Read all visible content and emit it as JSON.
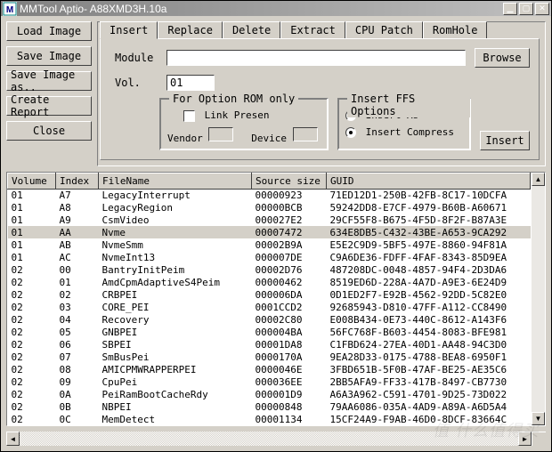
{
  "window": {
    "title": "MMTool Aptio- A88XMD3H.10a"
  },
  "sidebar": {
    "buttons": [
      {
        "label": "Load Image"
      },
      {
        "label": "Save Image"
      },
      {
        "label": "Save Image as.."
      },
      {
        "label": "Create Report"
      },
      {
        "label": "Close"
      }
    ]
  },
  "tabs": [
    {
      "label": "Insert",
      "active": true
    },
    {
      "label": "Replace"
    },
    {
      "label": "Delete"
    },
    {
      "label": "Extract"
    },
    {
      "label": "CPU Patch"
    },
    {
      "label": "RomHole"
    }
  ],
  "insert_tab": {
    "module_label": "Module",
    "module_value": "",
    "browse_label": "Browse",
    "vol_label": "Vol.",
    "vol_value": "01",
    "option_rom_group": {
      "legend": "For Option ROM only",
      "link_presen_label": "Link Presen",
      "link_presen_checked": false,
      "vendor_label": "Vendor",
      "vendor_value": "",
      "device_label": "Device",
      "device_value": ""
    },
    "ffs_group": {
      "legend": "Insert FFS Options",
      "insert_as_label": "Insert As",
      "insert_compress_label": "Insert Compress",
      "selected": "compress"
    },
    "insert_button_label": "Insert"
  },
  "table": {
    "columns": [
      "Volume",
      "Index",
      "FileName",
      "Source size",
      "GUID"
    ],
    "selected_index": 3,
    "rows": [
      {
        "vol": "01",
        "idx": "A7",
        "name": "LegacyInterrupt",
        "size": "00000923",
        "guid": "71ED12D1-250B-42FB-8C17-10DCFA"
      },
      {
        "vol": "01",
        "idx": "A8",
        "name": "LegacyRegion",
        "size": "00000BCB",
        "guid": "59242DD8-E7CF-4979-B60B-A60671"
      },
      {
        "vol": "01",
        "idx": "A9",
        "name": "CsmVideo",
        "size": "000027E2",
        "guid": "29CF55F8-B675-4F5D-8F2F-B87A3E"
      },
      {
        "vol": "01",
        "idx": "AA",
        "name": "Nvme",
        "size": "00007472",
        "guid": "634E8DB5-C432-43BE-A653-9CA292"
      },
      {
        "vol": "01",
        "idx": "AB",
        "name": "NvmeSmm",
        "size": "00002B9A",
        "guid": "E5E2C9D9-5BF5-497E-8860-94F81A"
      },
      {
        "vol": "01",
        "idx": "AC",
        "name": "NvmeInt13",
        "size": "000007DE",
        "guid": "C9A6DE36-FDFF-4FAF-8343-85D9EA"
      },
      {
        "vol": "02",
        "idx": "00",
        "name": "BantryInitPeim",
        "size": "00002D76",
        "guid": "487208DC-0048-4857-94F4-2D3DA6"
      },
      {
        "vol": "02",
        "idx": "01",
        "name": "AmdCpmAdaptiveS4Peim",
        "size": "00000462",
        "guid": "8519ED6D-228A-4A7D-A9E3-6E24D9"
      },
      {
        "vol": "02",
        "idx": "02",
        "name": "CRBPEI",
        "size": "000006DA",
        "guid": "0D1ED2F7-E92B-4562-92DD-5C82E0"
      },
      {
        "vol": "02",
        "idx": "03",
        "name": "CORE_PEI",
        "size": "0001CCD2",
        "guid": "92685943-D810-47FF-A112-CC8490"
      },
      {
        "vol": "02",
        "idx": "04",
        "name": "Recovery",
        "size": "00002C80",
        "guid": "E008B434-0E73-440C-8612-A143F6"
      },
      {
        "vol": "02",
        "idx": "05",
        "name": "GNBPEI",
        "size": "000004BA",
        "guid": "56FC768F-B603-4454-8083-BFE981"
      },
      {
        "vol": "02",
        "idx": "06",
        "name": "SBPEI",
        "size": "00001DA8",
        "guid": "C1FBD624-27EA-40D1-AA48-94C3D0"
      },
      {
        "vol": "02",
        "idx": "07",
        "name": "SmBusPei",
        "size": "0000170A",
        "guid": "9EA28D33-0175-4788-BEA8-6950F1"
      },
      {
        "vol": "02",
        "idx": "08",
        "name": "AMICPMWRAPPERPEI",
        "size": "0000046E",
        "guid": "3FBD651B-5F0B-47AF-BE25-AE35C6"
      },
      {
        "vol": "02",
        "idx": "09",
        "name": "CpuPei",
        "size": "000036EE",
        "guid": "2BB5AFA9-FF33-417B-8497-CB7730"
      },
      {
        "vol": "02",
        "idx": "0A",
        "name": "PeiRamBootCacheRdy",
        "size": "000001D9",
        "guid": "A6A3A962-C591-4701-9D25-73D022"
      },
      {
        "vol": "02",
        "idx": "0B",
        "name": "NBPEI",
        "size": "00000848",
        "guid": "79AA6086-035A-4AD9-A89A-A6D5A4"
      },
      {
        "vol": "02",
        "idx": "0C",
        "name": "MemDetect",
        "size": "00001134",
        "guid": "15CF24A9-F9AB-46D0-8DCF-83664C"
      }
    ]
  },
  "watermark": "值 什么值得买"
}
